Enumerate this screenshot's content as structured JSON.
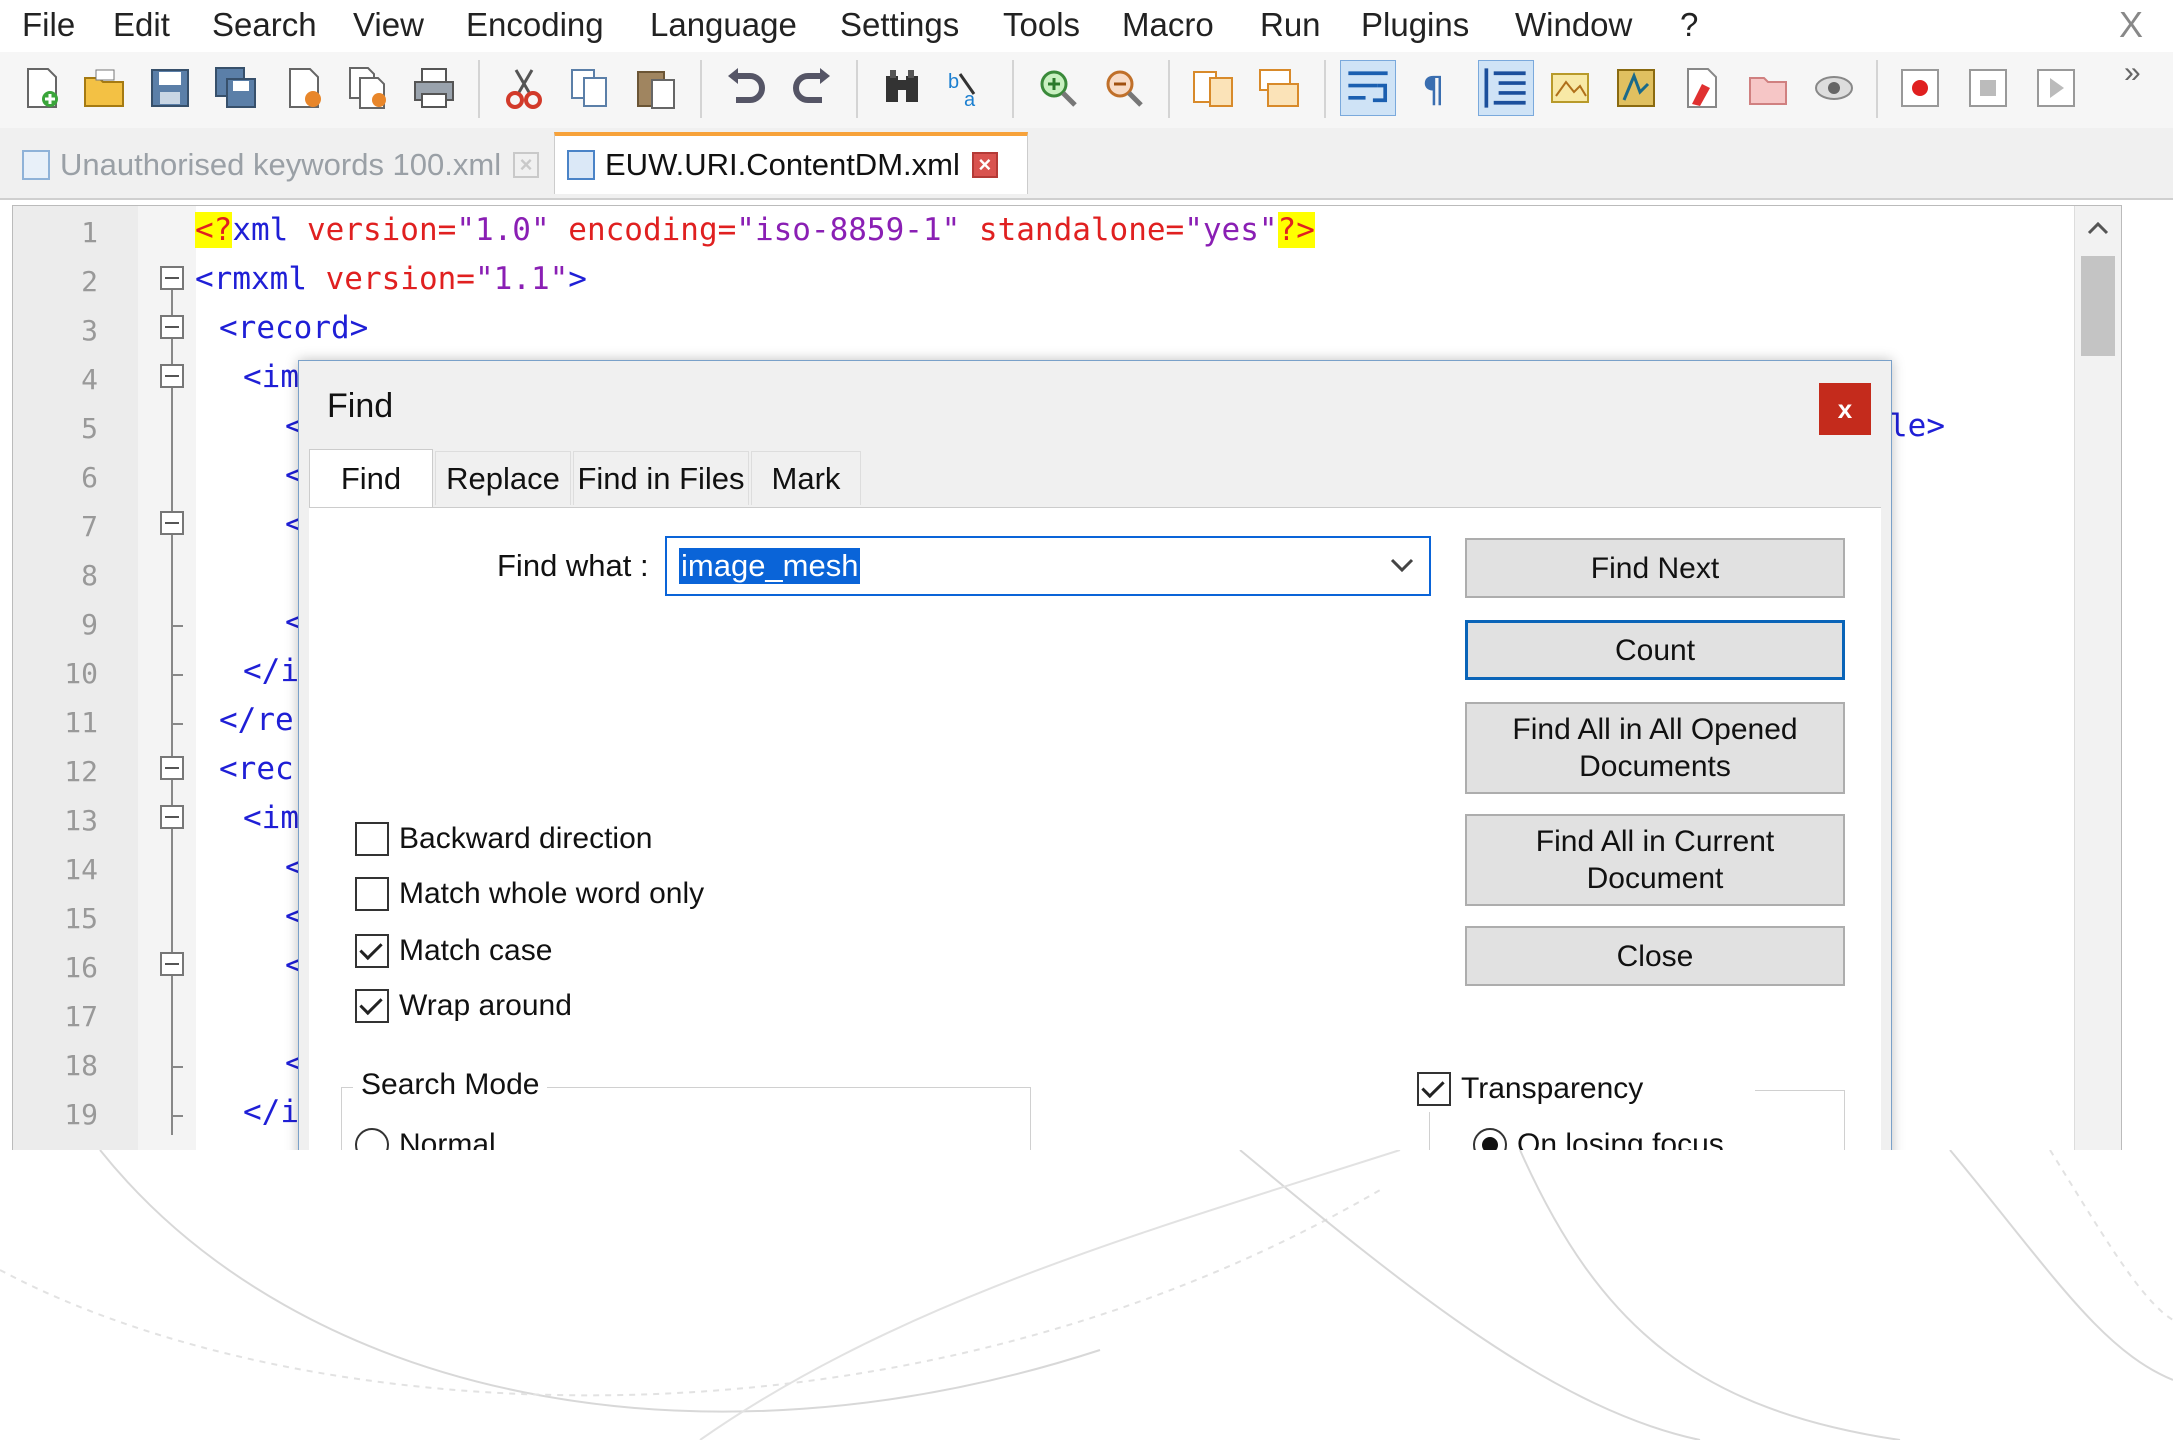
{
  "menu": {
    "items": [
      "File",
      "Edit",
      "Search",
      "View",
      "Encoding",
      "Language",
      "Settings",
      "Tools",
      "Macro",
      "Run",
      "Plugins",
      "Window",
      "?"
    ],
    "close_glyph": "X"
  },
  "toolbar": {
    "icons": [
      "new-file-icon",
      "open-file-icon",
      "save-icon",
      "save-all-icon",
      "close-icon",
      "close-all-icon",
      "print-icon",
      "cut-icon",
      "copy-icon",
      "paste-icon",
      "undo-icon",
      "redo-icon",
      "find-icon",
      "replace-icon",
      "zoom-in-icon",
      "zoom-out-icon",
      "sync-vertical-icon",
      "sync-horizontal-icon",
      "word-wrap-icon",
      "show-all-chars-icon",
      "indent-guide-icon",
      "doc-map-icon",
      "function-list-icon",
      "folder-workspace-icon",
      "file-browser-icon",
      "monitor-icon",
      "record-macro-icon",
      "stop-macro-icon",
      "play-macro-icon"
    ],
    "overflow": "»"
  },
  "tabs": [
    {
      "label": "Unauthorised keywords 100.xml",
      "active": false
    },
    {
      "label": "EUW.URI.ContentDM.xml",
      "active": true
    }
  ],
  "editor": {
    "line_numbers": [
      "1",
      "2",
      "3",
      "4",
      "5",
      "6",
      "7",
      "8",
      "9",
      "10",
      "11",
      "12",
      "13",
      "14",
      "15",
      "16",
      "17",
      "18",
      "19"
    ],
    "line1": {
      "open": "<?",
      "xml": "xml",
      "a1": " version=",
      "v1": "\"1.0\"",
      "a2": " encoding=",
      "v2": "\"iso-8859-1\"",
      "a3": " standalone=",
      "v3": "\"yes\"",
      "close": "?>"
    },
    "line2": {
      "tag": "<rmxml",
      "attr": " version=",
      "val": "\"1.1\"",
      "end": ">"
    },
    "line3": "<record>",
    "line4": "<im",
    "line5": "<",
    "line5_tail": "le>",
    "line6": "<",
    "line7": "<",
    "line9": "<",
    "line10": "</i",
    "line11": "</re",
    "line12": "<rec",
    "line13": "<im",
    "line14": "<",
    "line15": "<",
    "line16": "<",
    "line18": "<",
    "line19": "</i"
  },
  "dialog": {
    "title": "Find",
    "close_glyph": "x",
    "tabs": [
      "Find",
      "Replace",
      "Find in Files",
      "Mark"
    ],
    "find_what_label": "Find what :",
    "find_what_value": "image_mesh",
    "buttons": {
      "find_next": "Find Next",
      "count": "Count",
      "find_all_opened": "Find All in All Opened Documents",
      "find_all_current": "Find All in Current Document",
      "close": "Close"
    },
    "options": [
      {
        "label": "Backward direction",
        "checked": false
      },
      {
        "label": "Match whole word only",
        "checked": false
      },
      {
        "label": "Match case",
        "checked": true
      },
      {
        "label": "Wrap around",
        "checked": true
      }
    ],
    "search_mode": {
      "title": "Search Mode",
      "normal": "Normal"
    },
    "transparency": {
      "label": "Transparency",
      "checked": true,
      "on_losing_focus": "On losing focus"
    }
  },
  "colors": {
    "tag": "#1f1fd6",
    "attr": "#e02020",
    "value": "#8a1fb4",
    "highlight": "#ffff00",
    "selection": "#0a64d8"
  }
}
